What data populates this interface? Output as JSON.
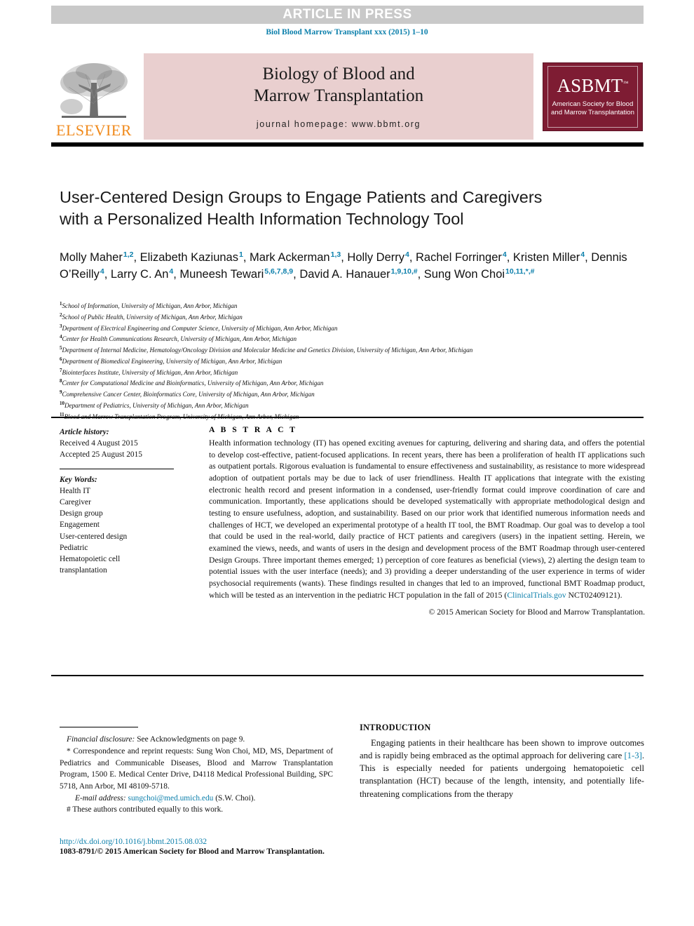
{
  "banner": {
    "text": "ARTICLE IN PRESS",
    "background": "#c9c9c9",
    "text_color": "#ffffff"
  },
  "journal_citation": "Biol Blood Marrow Transplant xxx (2015) 1–10",
  "masthead": {
    "publisher_name": "ELSEVIER",
    "publisher_color": "#f08a1c",
    "journal_title_line1": "Biology of Blood and",
    "journal_title_line2": "Marrow Transplantation",
    "homepage": "journal homepage: www.bbmt.org",
    "panel_color": "#e9cfcf",
    "society_logo": {
      "acronym": "ASBMT",
      "trademark": "™",
      "line1": "American Society for Blood",
      "line2": "and Marrow Transplantation",
      "color": "#7e1c33"
    }
  },
  "article": {
    "title": "User-Centered Design Groups to Engage Patients and Caregivers with a Personalized Health Information Technology Tool",
    "authors": [
      {
        "name": "Molly Maher",
        "sup": "1,2",
        "sep": ", "
      },
      {
        "name": "Elizabeth Kaziunas",
        "sup": "1",
        "sep": ", "
      },
      {
        "name": "Mark Ackerman",
        "sup": "1,3",
        "sep": ", "
      },
      {
        "name": "Holly Derry",
        "sup": "4",
        "sep": ", "
      },
      {
        "name": "Rachel Forringer",
        "sup": "4",
        "sep": ", "
      },
      {
        "name": "Kristen Miller",
        "sup": "4",
        "sep": ", "
      },
      {
        "name": "Dennis O’Reilly",
        "sup": "4",
        "sep": ", "
      },
      {
        "name": "Larry C. An",
        "sup": "4",
        "sep": ", "
      },
      {
        "name": "Muneesh Tewari",
        "sup": "5,6,7,8,9",
        "sep": ", "
      },
      {
        "name": "David A. Hanauer",
        "sup": "1,9,10,#",
        "sep": ", "
      },
      {
        "name": "Sung Won Choi",
        "sup": "10,11,*,#",
        "sep": ""
      }
    ],
    "affiliations": [
      {
        "num": "1",
        "text": "School of Information, University of Michigan, Ann Arbor, Michigan"
      },
      {
        "num": "2",
        "text": "School of Public Health, University of Michigan, Ann Arbor, Michigan"
      },
      {
        "num": "3",
        "text": "Department of Electrical Engineering and Computer Science, University of Michigan, Ann Arbor, Michigan"
      },
      {
        "num": "4",
        "text": "Center for Health Communications Research, University of Michigan, Ann Arbor, Michigan"
      },
      {
        "num": "5",
        "text": "Department of Internal Medicine, Hematology/Oncology Division and Molecular Medicine and Genetics Division, University of Michigan, Ann Arbor, Michigan"
      },
      {
        "num": "6",
        "text": "Department of Biomedical Engineering, University of Michigan, Ann Arbor, Michigan"
      },
      {
        "num": "7",
        "text": "Biointerfaces Institute, University of Michigan, Ann Arbor, Michigan"
      },
      {
        "num": "8",
        "text": "Center for Computational Medicine and Bioinformatics, University of Michigan, Ann Arbor, Michigan"
      },
      {
        "num": "9",
        "text": "Comprehensive Cancer Center, Bioinformatics Core, University of Michigan, Ann Arbor, Michigan"
      },
      {
        "num": "10",
        "text": "Department of Pediatrics, University of Michigan, Ann Arbor, Michigan"
      },
      {
        "num": "11",
        "text": "Blood and Marrow Transplantation Program, University of Michigan, Ann Arbor, Michigan"
      }
    ]
  },
  "meta": {
    "history_label": "Article history:",
    "received": "Received 4 August 2015",
    "accepted": "Accepted 25 August 2015",
    "keywords_label": "Key Words:",
    "keywords": [
      "Health IT",
      "Caregiver",
      "Design group",
      "Engagement",
      "User-centered design",
      "Pediatric",
      "Hematopoietic cell",
      "transplantation"
    ]
  },
  "abstract": {
    "heading": "A B S T R A C T",
    "part1": "Health information technology (IT) has opened exciting avenues for capturing, delivering and sharing data, and offers the potential to develop cost-effective, patient-focused applications. In recent years, there has been a proliferation of health IT applications such as outpatient portals. Rigorous evaluation is fundamental to ensure effectiveness and sustainability, as resistance to more widespread adoption of outpatient portals may be due to lack of user friendliness. Health IT applications that integrate with the existing electronic health record and present information in a condensed, user-friendly format could improve coordination of care and communication. Importantly, these applications should be developed systematically with appropriate methodological design and testing to ensure usefulness, adoption, and sustainability. Based on our prior work that identified numerous information needs and challenges of HCT, we developed an experimental prototype of a health IT tool, the BMT Roadmap. Our goal was to develop a tool that could be used in the real-world, daily practice of HCT patients and caregivers (users) in the inpatient setting. Herein, we examined the views, needs, and wants of users in the design and development process of the BMT Roadmap through user-centered Design Groups. Three important themes emerged; 1) perception of core features as beneficial (views), 2) alerting the design team to potential issues with the user interface (needs); and 3) providing a deeper understanding of the user experience in terms of wider psychosocial requirements (wants). These findings resulted in changes that led to an improved, functional BMT Roadmap product, which will be tested as an intervention in the pediatric HCT population in the fall of 2015 (",
    "link_text": "ClinicalTrials.gov",
    "part2": " NCT02409121).",
    "copyright": "© 2015 American Society for Blood and Marrow Transplantation."
  },
  "footnotes": {
    "financial_label": "Financial disclosure:",
    "financial_text": " See Acknowledgments on page 9.",
    "correspondence_marker": "*",
    "correspondence_text": " Correspondence and reprint requests: Sung Won Choi, MD, MS, Department of Pediatrics and Communicable Diseases, Blood and Marrow Transplantation Program, 1500 E. Medical Center Drive, D4118 Medical Professional Building, SPC 5718, Ann Arbor, MI 48109-5718.",
    "email_label": "E-mail address:",
    "email": "sungchoi@med.umich.edu",
    "email_suffix": " (S.W. Choi).",
    "equal_marker": "#",
    "equal_text": " These authors contributed equally to this work."
  },
  "introduction": {
    "heading": "INTRODUCTION",
    "text_before_ref": "Engaging patients in their healthcare has been shown to improve outcomes and is rapidly being embraced as the optimal approach for delivering care ",
    "reference": "[1-3]",
    "text_after_ref": ". This is especially needed for patients undergoing hematopoietic cell transplantation (HCT) because of the length, intensity, and potentially life-threatening complications from the therapy"
  },
  "footer": {
    "doi": "http://dx.doi.org/10.1016/j.bbmt.2015.08.032",
    "issn": "1083-8791/© 2015 American Society for Blood and Marrow Transplantation."
  },
  "colors": {
    "link": "#0b7fab",
    "rule": "#000000"
  }
}
